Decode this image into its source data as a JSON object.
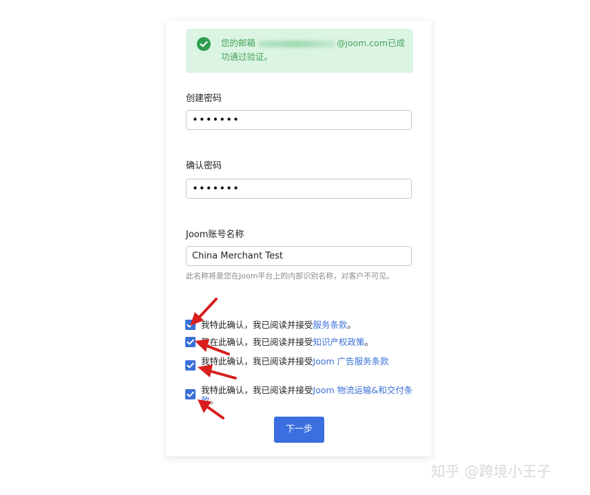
{
  "alert": {
    "prefix": "您的邮箱",
    "suffix": "@joom.com已成功通过验证。"
  },
  "form": {
    "create_password_label": "创建密码",
    "create_password_value": "•••••••",
    "confirm_password_label": "确认密码",
    "confirm_password_value": "•••••••",
    "account_name_label": "Joom账号名称",
    "account_name_value": "China Merchant Test",
    "account_name_hint": "此名称将是您在Joom平台上的内部识别名称，对客户不可见。"
  },
  "checkboxes": [
    {
      "text_a": "我特此确认，我已阅读并接受",
      "link": "服务条款",
      "text_b": "。",
      "checked": true
    },
    {
      "text_a": "我在此确认，我已阅读并接受",
      "link": "知识产权政策",
      "text_b": "。",
      "checked": true
    },
    {
      "text_a": "我特此确认，我已阅读并接受",
      "link": "Joom 广告服务条款",
      "text_b": "",
      "checked": true
    },
    {
      "text_a": "我特此确认，我已阅读并接受",
      "link": "Joom 物流运输&和交付条款",
      "text_b": "。",
      "checked": true
    }
  ],
  "next_button": "下一步",
  "watermark": "知乎 @跨境小王子",
  "colors": {
    "accent": "#3b6fe0",
    "success_bg": "#dcf4e3",
    "success_text": "#43a35b",
    "arrow": "#d81e1e"
  }
}
